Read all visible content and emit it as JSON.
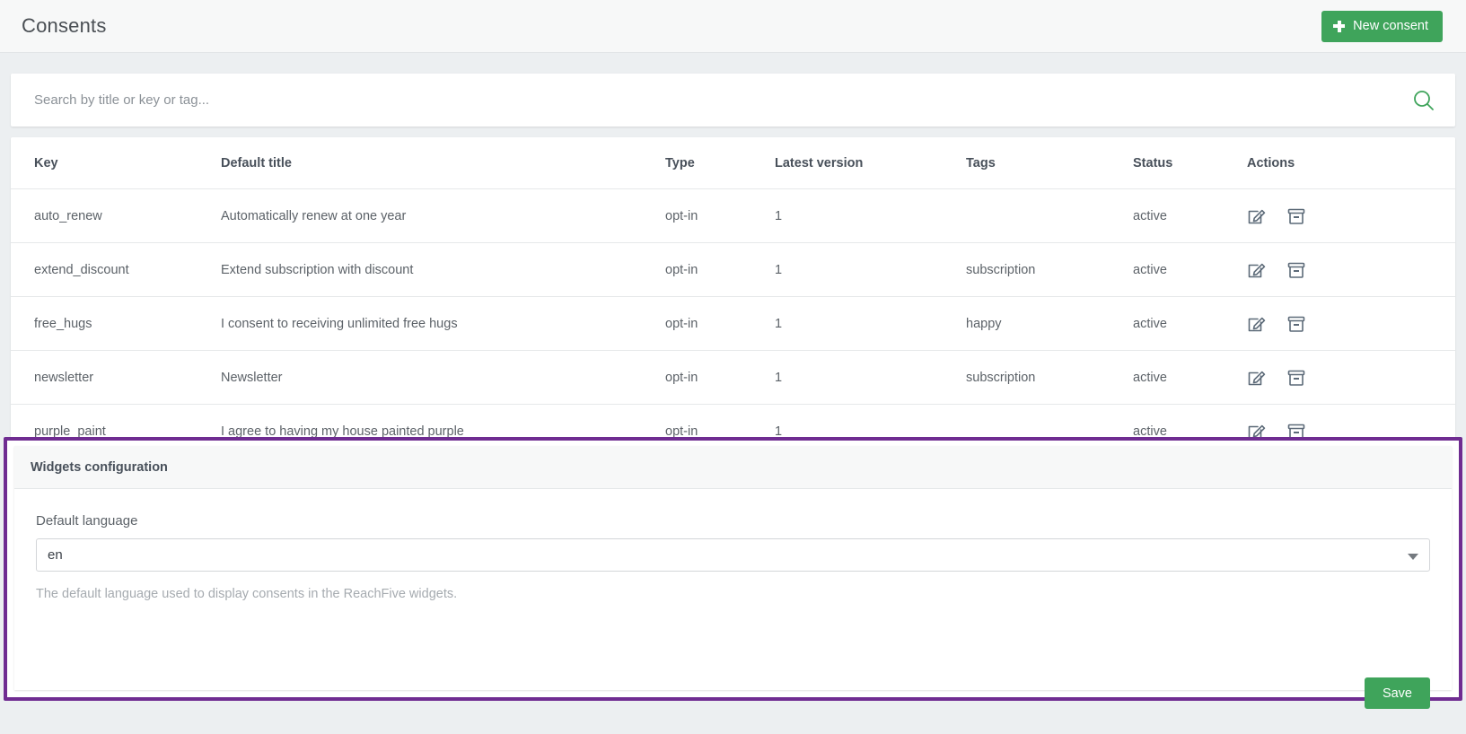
{
  "header": {
    "title": "Consents",
    "new_consent_label": "New consent",
    "new_consent_icon": "plus-icon"
  },
  "search": {
    "placeholder": "Search by title or key or tag...",
    "value": "",
    "icon": "search-icon"
  },
  "table": {
    "columns": [
      "Key",
      "Default title",
      "Type",
      "Latest version",
      "Tags",
      "Status",
      "Actions"
    ],
    "rows": [
      {
        "key": "auto_renew",
        "default_title": "Automatically renew at one year",
        "type": "opt-in",
        "latest_version": "1",
        "tags": "",
        "status": "active"
      },
      {
        "key": "extend_discount",
        "default_title": "Extend subscription with discount",
        "type": "opt-in",
        "latest_version": "1",
        "tags": "subscription",
        "status": "active"
      },
      {
        "key": "free_hugs",
        "default_title": "I consent to receiving unlimited free hugs",
        "type": "opt-in",
        "latest_version": "1",
        "tags": "happy",
        "status": "active"
      },
      {
        "key": "newsletter",
        "default_title": "Newsletter",
        "type": "opt-in",
        "latest_version": "1",
        "tags": "subscription",
        "status": "active"
      },
      {
        "key": "purple_paint",
        "default_title": "I agree to having my house painted purple",
        "type": "opt-in",
        "latest_version": "1",
        "tags": "",
        "status": "active"
      }
    ],
    "row_actions": [
      {
        "name": "edit-icon"
      },
      {
        "name": "archive-icon"
      }
    ]
  },
  "widgets_configuration": {
    "title": "Widgets configuration",
    "language_label": "Default language",
    "language_value": "en",
    "language_options": [
      "en"
    ],
    "help_text": "The default language used to display consents in the ReachFive widgets.",
    "save_label": "Save",
    "highlight_color": "#6f2c91"
  },
  "colors": {
    "accent_green": "#3fa45b",
    "page_background": "#eceff1",
    "text_primary": "#48505a",
    "text_secondary": "#5c6268"
  }
}
